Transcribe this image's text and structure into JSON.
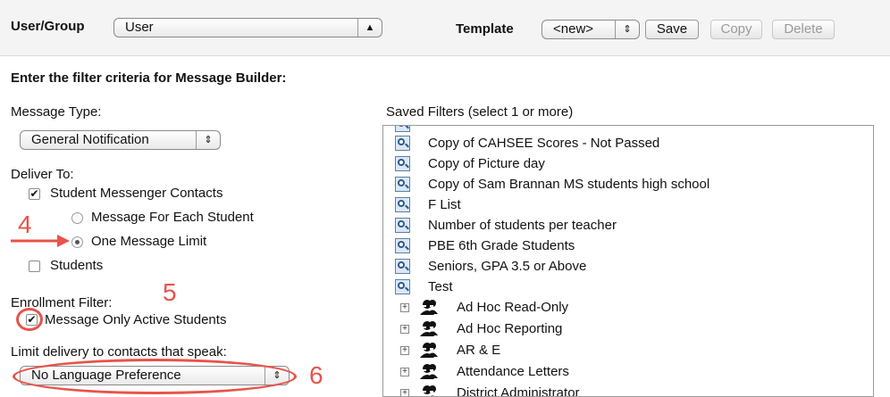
{
  "header": {
    "user_group_label": "User/Group",
    "user_group_value": "User",
    "template_label": "Template",
    "template_value": "<new>",
    "save_label": "Save",
    "copy_label": "Copy",
    "delete_label": "Delete"
  },
  "form": {
    "title": "Enter the filter criteria for Message Builder:",
    "message_type_label": "Message Type:",
    "message_type_value": "General Notification",
    "deliver_to_label": "Deliver To:",
    "student_messenger_contacts": "Student Messenger Contacts",
    "message_for_each_student": "Message For Each Student",
    "one_message_limit": "One Message Limit",
    "students": "Students",
    "enrollment_filter_label": "Enrollment Filter:",
    "message_only_active_students": "Message Only Active Students",
    "limit_delivery_label": "Limit delivery to contacts that speak:",
    "language_value": "No Language Preference"
  },
  "saved_filters": {
    "label": "Saved Filters (select 1 or more)",
    "items": [
      "Copy of CAHSEE Scores - Not Passed",
      "Copy of Picture day",
      "Copy of Sam Brannan MS students high school",
      "F List",
      "Number of students per teacher",
      "PBE 6th Grade Students",
      "Seniors, GPA 3.5 or Above",
      "Test"
    ],
    "groups": [
      "Ad Hoc Read-Only",
      "Ad Hoc Reporting",
      "AR & E",
      "Attendance Letters",
      "District Administrator"
    ]
  },
  "annotations": {
    "n4": "4",
    "n5": "5",
    "n6": "6"
  },
  "colors": {
    "annotation": "#e8534a"
  }
}
